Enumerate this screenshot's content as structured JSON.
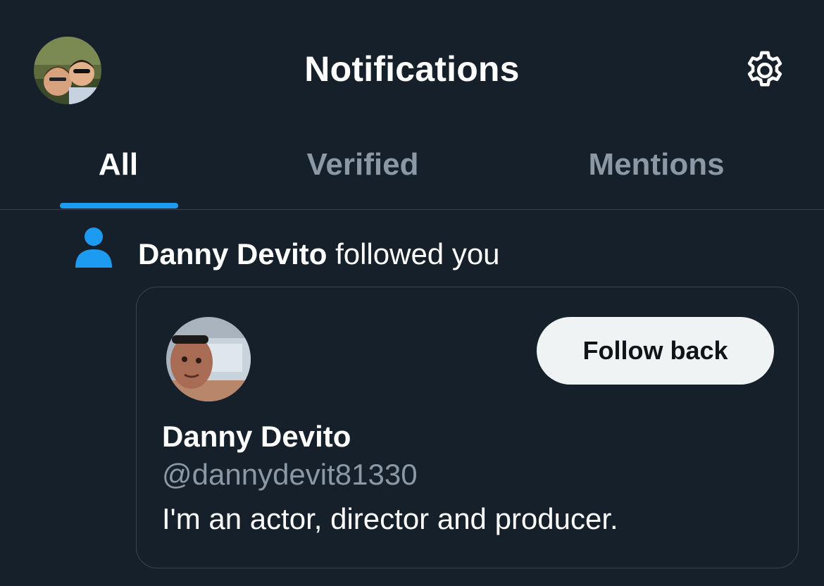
{
  "header": {
    "title": "Notifications",
    "profile_avatar_icon": "user-avatar-photo",
    "settings_icon": "gear-icon"
  },
  "tabs": [
    {
      "label": "All",
      "active": true
    },
    {
      "label": "Verified",
      "active": false
    },
    {
      "label": "Mentions",
      "active": false
    }
  ],
  "notification": {
    "icon": "person-icon",
    "actor": "Danny Devito",
    "action": "followed you",
    "card": {
      "name": "Danny Devito",
      "handle": "@dannydevit81330",
      "bio": "I'm an actor, director and producer.",
      "follow_label": "Follow back",
      "avatar_icon": "user-avatar-photo"
    }
  },
  "colors": {
    "background": "#15202b",
    "accent": "#1d9bf0",
    "muted_text": "#8b98a5",
    "divider": "#38444d",
    "button_bg": "#eff3f4"
  }
}
